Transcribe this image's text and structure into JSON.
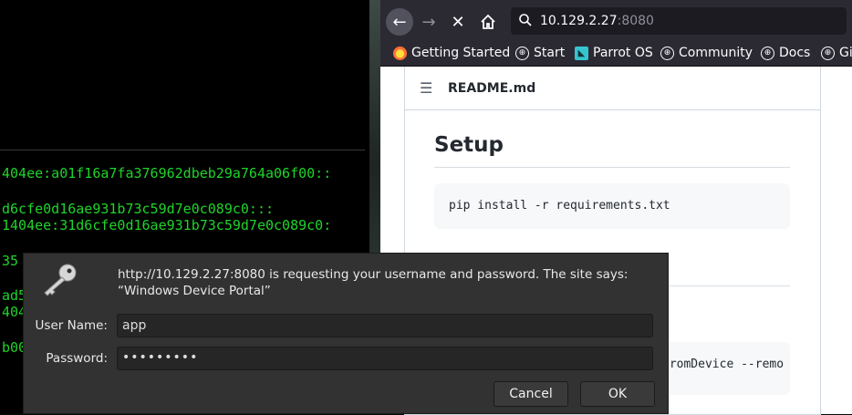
{
  "terminal": {
    "lines": [
      "404ee:a01f16a7fa376962dbeb29a764a06f00::",
      "d6cfe0d16ae931b73c59d7e0c089c0:::",
      "1404ee:31d6cfe0d16ae931b73c59d7e0c089c0:",
      "35",
      "ad5",
      "404",
      "b00"
    ]
  },
  "browser": {
    "url_host": "10.129.2.27",
    "url_port": ":8080",
    "bookmarks": [
      "Getting Started",
      "Start",
      "Parrot OS",
      "Community",
      "Docs",
      "Gi"
    ]
  },
  "page": {
    "readme_title": "README.md",
    "setup_heading": "Setup",
    "code_install": "pip install -r requirements.txt",
    "code_partial": "FromDevice --remo"
  },
  "dialog": {
    "message_line1": "http://10.129.2.27:8080 is requesting your username and password. The site says:",
    "message_line2": "“Windows Device Portal”",
    "username_label": "User Name:",
    "username_value": "app",
    "password_label": "Password:",
    "password_value": "•••••••••",
    "cancel_label": "Cancel",
    "ok_label": "OK"
  },
  "colors": {
    "terminal_text": "#1fd42a",
    "browser_chrome": "#2b2a33",
    "dialog_bg": "#323232"
  }
}
